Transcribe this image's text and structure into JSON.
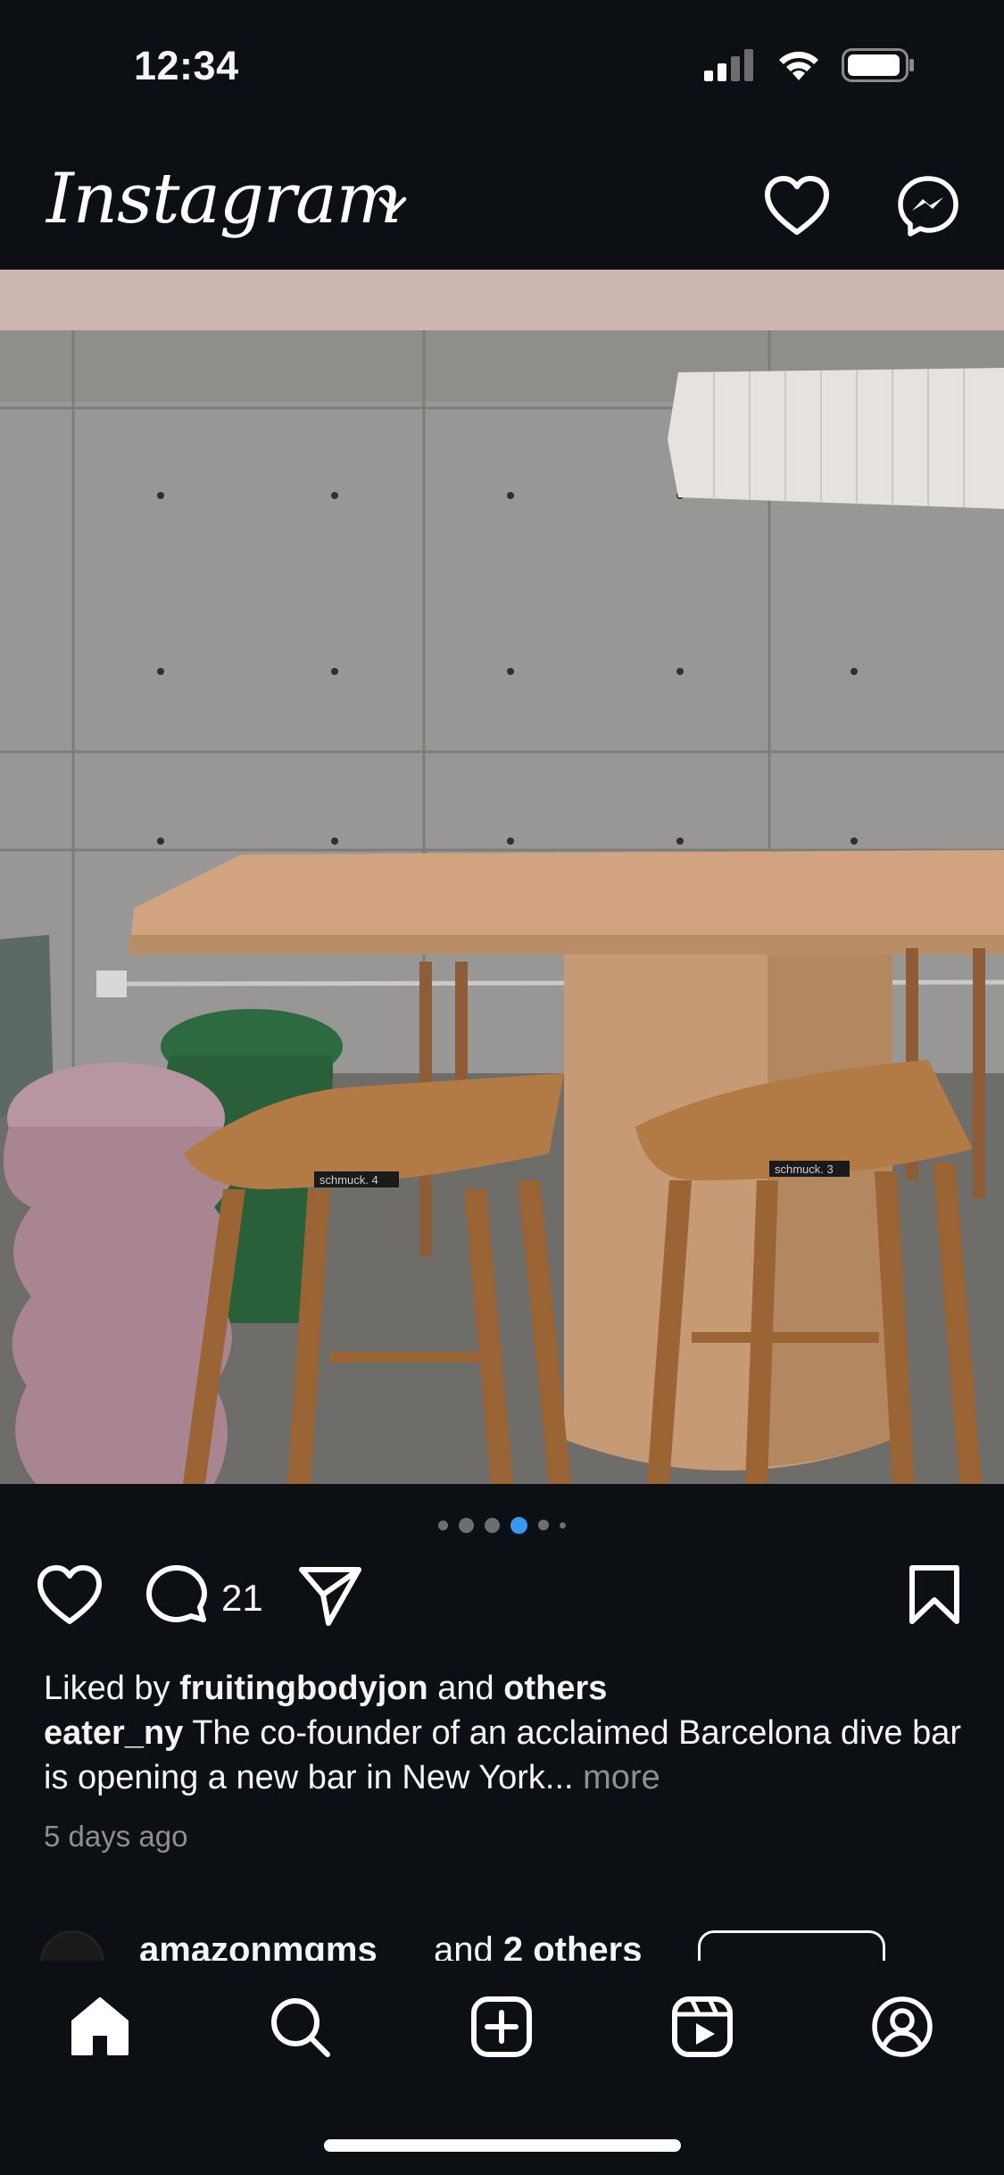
{
  "status_bar": {
    "time": "12:34"
  },
  "header": {
    "logo_text": "Instagram"
  },
  "carousel": {
    "dot_count": 6,
    "active_index": 3
  },
  "post": {
    "comment_count": "21",
    "stool_label_1": "schmuck. 4",
    "stool_label_2": "schmuck. 3"
  },
  "caption": {
    "liked_prefix": "Liked by",
    "liked_user": "fruitingbodyjon",
    "liked_and": "and",
    "liked_others": "others",
    "author": "eater_ny",
    "text": "The co-founder of an acclaimed Barcelona dive bar is opening a new bar in New York...",
    "more": "more",
    "time_ago": "5 days ago"
  },
  "next_post": {
    "username": "amazonmgms",
    "others_prefix": "and",
    "others": "2 others"
  },
  "colors": {
    "background": "#0c1014",
    "text": "#f5f5f5",
    "muted": "#8e8e8e",
    "active_dot": "#3897f0"
  }
}
